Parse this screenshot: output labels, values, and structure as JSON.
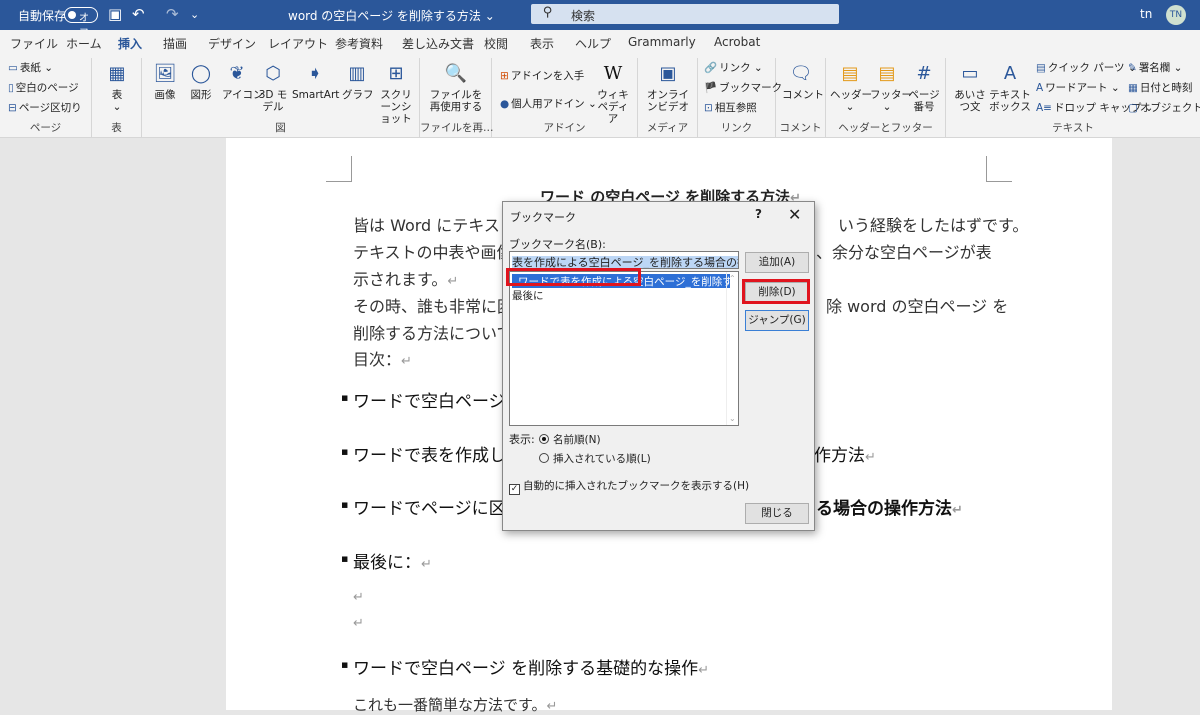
{
  "titlebar": {
    "autosave": "自動保存",
    "toggle": "オフ",
    "doc_title": "word の空白ページ を削除する方法 ⌄",
    "search": "検索",
    "user_initials": "tn",
    "avatar": "TN",
    "icons": {
      "save": "save-icon",
      "undo": "undo-icon",
      "redo": "redo-icon",
      "search": "search-icon"
    }
  },
  "tabs": [
    "ファイル",
    "ホーム",
    "挿入",
    "描画",
    "デザイン",
    "レイアウト",
    "参考資料",
    "差し込み文書",
    "校閲",
    "表示",
    "ヘルプ",
    "Grammarly",
    "Acrobat"
  ],
  "active_tab": "挿入",
  "ribbon": {
    "pages": {
      "label": "ページ",
      "items": [
        "表紙 ⌄",
        "空白のページ",
        "ページ区切り"
      ]
    },
    "table": {
      "label": "表",
      "btn": "表"
    },
    "illust": {
      "label": "図",
      "items": [
        "画像",
        "図形",
        "アイコン",
        "3D モデル",
        "SmartArt",
        "グラフ",
        "スクリーンショット"
      ]
    },
    "reuse": {
      "label": "ファイルを再…",
      "btn": "ファイルを再使用する"
    },
    "addins": {
      "label": "アドイン",
      "items": [
        "アドインを入手",
        "個人用アドイン ⌄"
      ],
      "wiki": "ウィキペディア"
    },
    "media": {
      "label": "メディア",
      "btn": "オンラインビデオ"
    },
    "links": {
      "label": "リンク",
      "items": [
        "リンク ⌄",
        "ブックマーク",
        "相互参照"
      ]
    },
    "comments": {
      "label": "コメント",
      "btn": "コメント"
    },
    "hf": {
      "label": "ヘッダーとフッター",
      "items": [
        "ヘッダー",
        "フッター",
        "ページ番号"
      ]
    },
    "text": {
      "label": "テキスト",
      "items": [
        "あいさつ文",
        "テキストボックス"
      ],
      "small": [
        "クイック パーツ ⌄",
        "ワードアート ⌄",
        "ドロップ キャップ ⌄",
        "署名欄 ⌄",
        "日付と時刻",
        "オブジェクト ⌄"
      ]
    }
  },
  "document": {
    "title": "ワード の空白ページ を削除する方法",
    "lines": [
      "皆は Word にテキスト",
      "いう経験をしたはずです。",
      "テキストの中表や画像",
      "、余分な空白ページが表",
      "示されます。",
      "その時、誰も非常に困",
      "除 word の空白ページ を",
      "削除する方法について",
      "目次："
    ],
    "bullets": [
      "ワードで空白ページ",
      "ワードで表を作成し",
      "作方法",
      "ワードでページに区",
      "る場合の操作方法",
      "最後に：",
      "ワードで空白ページ を削除する基礎的な操作"
    ],
    "last_line": "これも一番簡単な方法です。"
  },
  "dialog": {
    "title": "ブックマーク",
    "help": "?",
    "close": "✕",
    "name_label": "ブックマーク名(B):",
    "name_value": "表を作成による空白ページ_を削除する場合の操作方法",
    "list": [
      "ワードで表を作成による空白ページ_を削除する場合",
      "最後に"
    ],
    "buttons": {
      "add": "追加(A)",
      "delete": "削除(D)",
      "jump": "ジャンプ(G)",
      "close": "閉じる"
    },
    "sort_label": "表示:",
    "sort_options": [
      "名前順(N)",
      "挿入されている順(L)"
    ],
    "checkbox": "自動的に挿入されたブックマークを表示する(H)"
  }
}
